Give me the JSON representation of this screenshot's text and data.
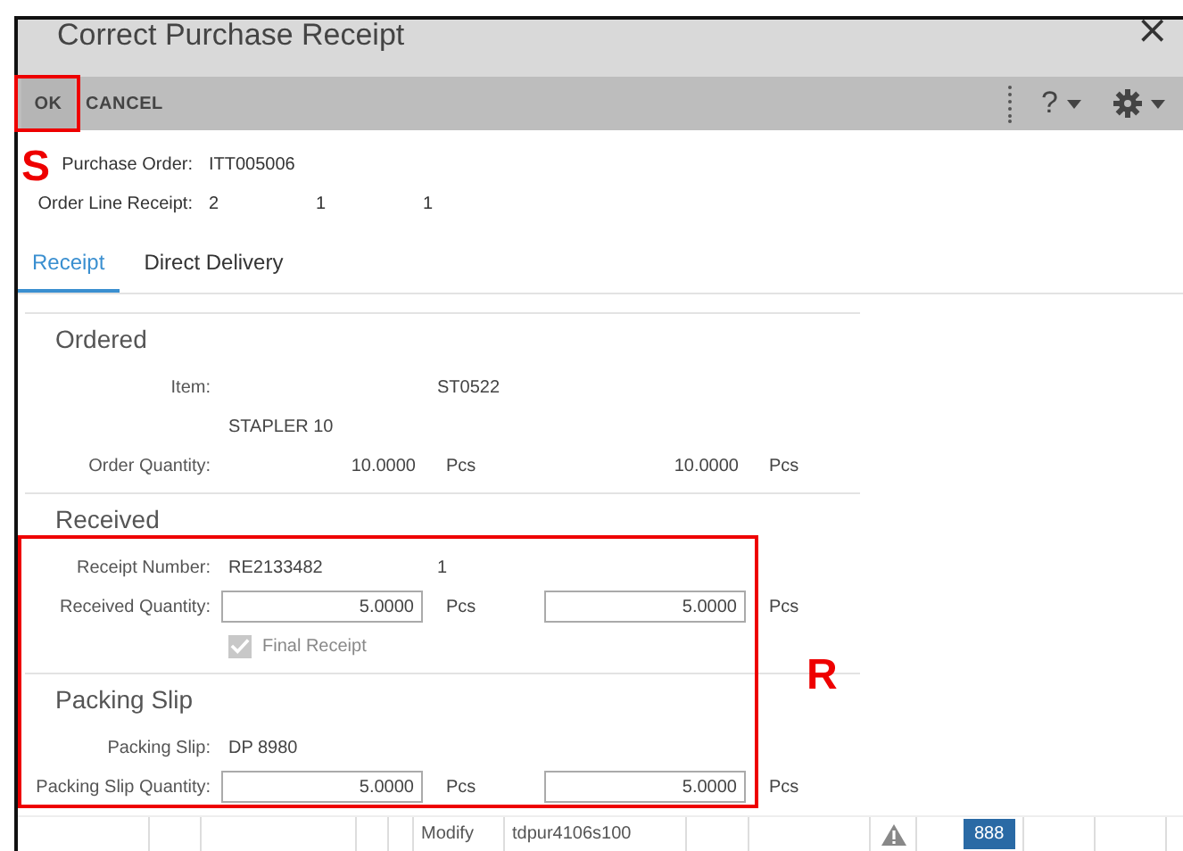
{
  "window": {
    "title": "Correct Purchase Receipt",
    "close": "×"
  },
  "toolbar": {
    "buttons": [
      {
        "label": "OK"
      },
      {
        "label": "CANCEL"
      }
    ],
    "help": "?"
  },
  "header": [
    {
      "label": "Purchase Order:",
      "values": [
        "ITT005006"
      ]
    },
    {
      "label": "Order Line Receipt:",
      "values": [
        "2",
        "1",
        "1"
      ]
    }
  ],
  "tabs": [
    {
      "label": "Receipt",
      "selected": true
    },
    {
      "label": "Direct Delivery",
      "selected": false
    }
  ],
  "sections": [
    {
      "title": "Ordered",
      "rows": [
        {
          "kind": "text",
          "label": "Item:",
          "extra": "ST0522"
        },
        {
          "kind": "text",
          "value": "STAPLER 10"
        },
        {
          "kind": "quantity",
          "label": "Order Quantity:",
          "editable": false,
          "quantities": [
            {
              "value": "10.0000",
              "unit": "Pcs"
            },
            {
              "value": "10.0000",
              "unit": "Pcs"
            }
          ]
        }
      ]
    },
    {
      "title": "Received",
      "rows": [
        {
          "kind": "text",
          "label": "Receipt Number:",
          "value": "RE2133482",
          "extra": "1"
        },
        {
          "kind": "quantity",
          "label": "Received Quantity:",
          "editable": true,
          "quantities": [
            {
              "value": "5.0000",
              "unit": "Pcs"
            },
            {
              "value": "5.0000",
              "unit": "Pcs"
            }
          ]
        },
        {
          "kind": "checkbox",
          "label": "Final Receipt",
          "checked": true,
          "disabled": true
        }
      ]
    },
    {
      "title": "Packing Slip",
      "rows": [
        {
          "kind": "text",
          "label": "Packing Slip:",
          "value": "DP 8980"
        },
        {
          "kind": "quantity",
          "label": "Packing Slip Quantity:",
          "editable": true,
          "quantities": [
            {
              "value": "5.0000",
              "unit": "Pcs"
            },
            {
              "value": "5.0000",
              "unit": "Pcs"
            }
          ]
        }
      ]
    }
  ],
  "status_bar": {
    "action": "Modify",
    "session": "tdpur4106s100",
    "badge": "888"
  },
  "annotations": [
    {
      "label": "S"
    },
    {
      "label": "R"
    }
  ]
}
